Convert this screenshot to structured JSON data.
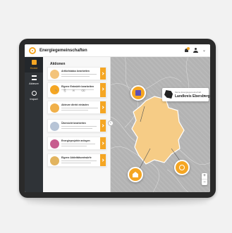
{
  "app": {
    "title": "Energiegemeinschaften"
  },
  "nav": {
    "items": [
      {
        "label": "Home",
        "icon": "home-icon",
        "active": true
      },
      {
        "label": "Akteure",
        "icon": "layers-icon",
        "active": false
      },
      {
        "label": "Import",
        "icon": "globe-icon",
        "active": false
      }
    ]
  },
  "panel": {
    "title": "Aktionen",
    "cards": [
      {
        "title": "Artikelstatus bearbeiten",
        "color": "#f3c37a"
      },
      {
        "title": "Eigene Entwürfe bearbeiten",
        "color": "#f5a623"
      },
      {
        "title": "Akteure direkt einladen",
        "color": "#f0b04a"
      },
      {
        "title": "Übersicht bearbeiten",
        "color": "#b7c4d6"
      },
      {
        "title": "Energieprojekte anlegen",
        "color": "#c75d8f"
      },
      {
        "title": "Eigene Aktivitätsentwürfe",
        "color": "#e2b45f"
      }
    ],
    "card_actions": [
      "✎",
      "⎘",
      "✉",
      "⌫"
    ]
  },
  "map": {
    "region_subtitle": "Meine Energiegemeinschaft",
    "region_title": "Landkreis Ebersberg",
    "colors": {
      "region": "#f6cc86",
      "background": "#b3b3b3",
      "accent": "#f5a623"
    }
  },
  "zoom": {
    "plus": "+",
    "minus": "−"
  }
}
